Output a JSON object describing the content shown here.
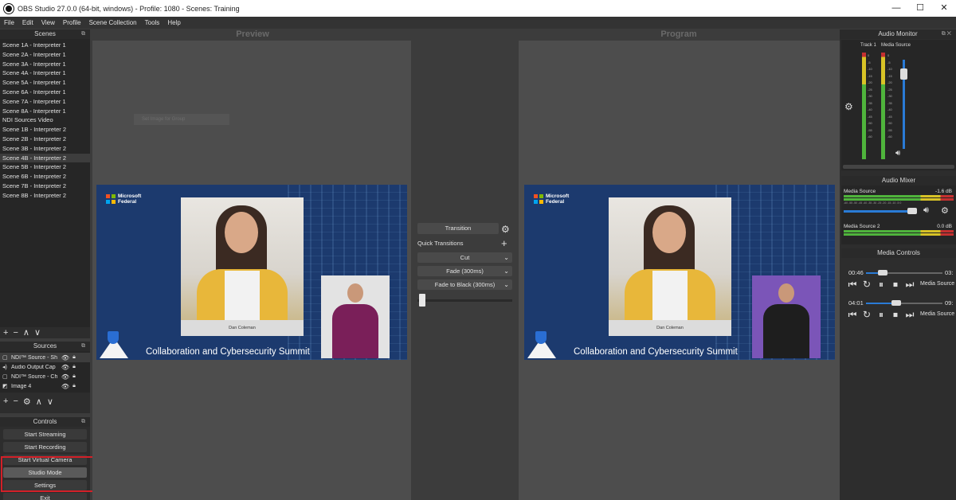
{
  "window": {
    "title": "OBS Studio 27.0.0 (64-bit, windows) - Profile: 1080 - Scenes: Training",
    "controls": [
      "—",
      "☐",
      "✕"
    ]
  },
  "menu": [
    "File",
    "Edit",
    "View",
    "Profile",
    "Scene Collection",
    "Tools",
    "Help"
  ],
  "scenes": {
    "title": "Scenes",
    "items": [
      "Scene 1A - Interpreter 1",
      "Scene 2A - Interpreter 1",
      "Scene 3A - Interpreter 1",
      "Scene 4A - Interpreter 1",
      "Scene 5A - Interpreter 1",
      "Scene 6A - Interpreter 1",
      "Scene 7A - Interpreter 1",
      "Scene 8A - Interpreter 1",
      "NDI Sources Video",
      "Scene 1B - Interpreter 2",
      "Scene 2B - Interpreter 2",
      "Scene 3B - Interpreter 2",
      "Scene 4B - Interpreter 2",
      "Scene 5B - Interpreter 2",
      "Scene 6B - Interpreter 2",
      "Scene 7B - Interpreter 2",
      "Scene 8B - Interpreter 2"
    ],
    "active_index": 12,
    "tools": [
      "+",
      "−",
      "∧",
      "∨"
    ]
  },
  "sources": {
    "title": "Sources",
    "items": [
      {
        "icon": "display-icon",
        "glyph": "▢",
        "label": "NDI™ Source - Sh"
      },
      {
        "icon": "speaker-icon",
        "glyph": "◂)",
        "label": "Audio Output Cap"
      },
      {
        "icon": "display-icon",
        "glyph": "▢",
        "label": "NDI™ Source - Ch"
      },
      {
        "icon": "image-icon",
        "glyph": "◩",
        "label": "Image 4"
      }
    ],
    "tools": [
      "+",
      "−",
      "⚙",
      "∧",
      "∨"
    ]
  },
  "controls": {
    "title": "Controls",
    "buttons": [
      "Start Streaming",
      "Start Recording",
      "Start Virtual Camera",
      "Studio Mode",
      "Settings",
      "Exit"
    ]
  },
  "preview": {
    "label": "Preview",
    "ghost": "Set Image for Group"
  },
  "program": {
    "label": "Program"
  },
  "canvas": {
    "brand_line1": "Microsoft",
    "brand_line2": "Federal",
    "nameplate": "Dan Coleman",
    "event_title": "Collaboration and Cybersecurity Summit"
  },
  "transition": {
    "button": "Transition",
    "quick_label": "Quick Transitions",
    "selects": [
      "Cut",
      "Fade (300ms)",
      "Fade to Black (300ms)"
    ]
  },
  "audio_monitor": {
    "title": "Audio Monitor",
    "col1": "Track 1",
    "col2": "Media Source",
    "scale": [
      "0",
      "-5",
      "-10",
      "-15",
      "-20",
      "-25",
      "-30",
      "-35",
      "-40",
      "-45",
      "-50",
      "-55",
      "-60"
    ]
  },
  "audio_mixer": {
    "title": "Audio Mixer",
    "channels": [
      {
        "name": "Media Source",
        "db": "-1.6 dB"
      },
      {
        "name": "Media Source 2",
        "db": "0.0 dB"
      }
    ],
    "ticks": "-60 -55 -50 -45 -40 -35 -30 -25 -20 -15 -10 -5 0"
  },
  "media_controls": {
    "title": "Media Controls",
    "players": [
      {
        "time": "00:46",
        "end": "03:",
        "source": "Media Source",
        "progress": 0.22
      },
      {
        "time": "04:01",
        "end": "09:",
        "source": "Media Source",
        "progress": 0.4
      }
    ],
    "buttons": [
      "⏮",
      "↻",
      "⏸",
      "⏹",
      "⏭"
    ]
  },
  "colors": {
    "highlight": "#d32028",
    "accent": "#2a7bd6",
    "canvas_bg": "#1c3a6e"
  }
}
